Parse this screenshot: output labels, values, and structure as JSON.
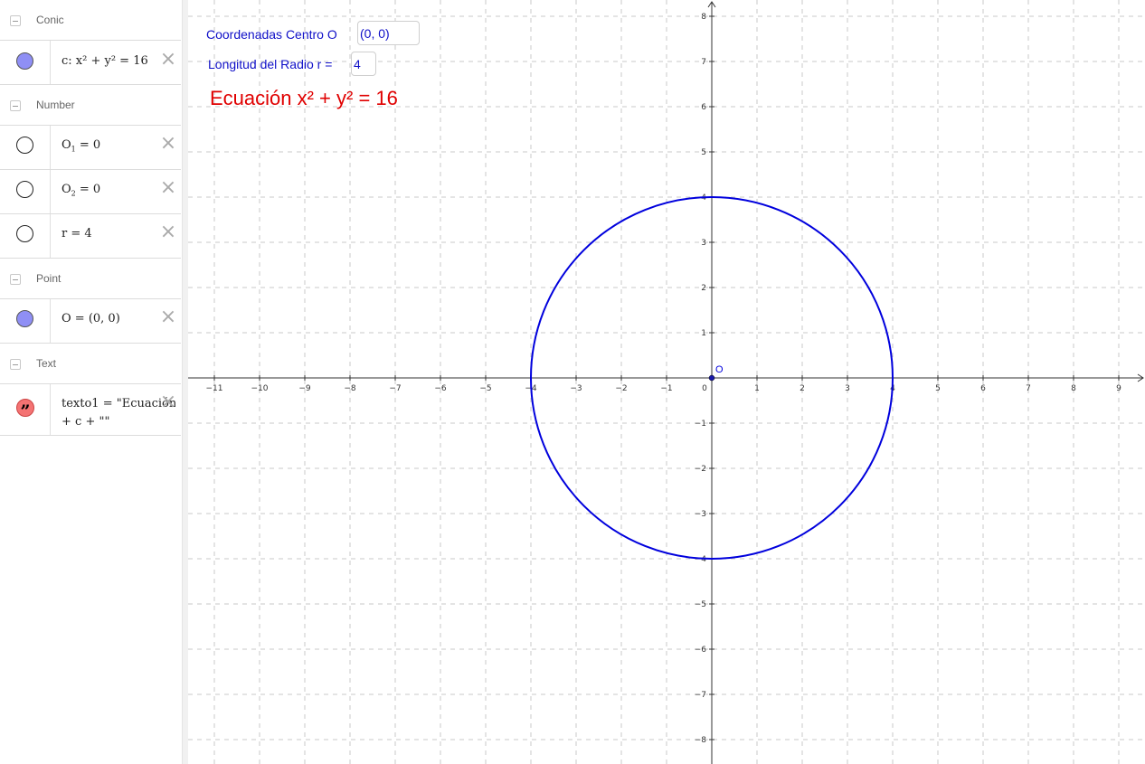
{
  "algebra": {
    "groups": [
      {
        "title": "Conic",
        "items": [
          {
            "expr": "c: x² + y² = 16",
            "icon": "filled-circle"
          }
        ]
      },
      {
        "title": "Number",
        "items": [
          {
            "expr_base": "O",
            "expr_sub": "1",
            "expr_rest": " = 0",
            "icon": "empty-circle"
          },
          {
            "expr_base": "O",
            "expr_sub": "2",
            "expr_rest": " = 0",
            "icon": "empty-circle"
          },
          {
            "expr": "r = 4",
            "icon": "empty-circle"
          }
        ]
      },
      {
        "title": "Point",
        "items": [
          {
            "expr": "O = (0, 0)",
            "icon": "filled-circle"
          }
        ]
      },
      {
        "title": "Text",
        "items": [
          {
            "expr_line1": "texto1 = \"Ecuación \"",
            "expr_line2": "+ c + \"\"",
            "icon": "quote-icon"
          }
        ]
      }
    ],
    "delete_glyph": "×"
  },
  "graphics": {
    "center_label": "Coordenadas Centro O",
    "center_value": "(0, 0)",
    "radius_label": "Longitud del Radio r =",
    "radius_value": "4",
    "equation": "Ecuación x² + y² = 16",
    "point_label": "O",
    "x_range": [
      -11,
      9
    ],
    "y_range": [
      -8,
      8
    ],
    "circle": {
      "center": [
        0,
        0
      ],
      "radius": 4
    },
    "point": [
      0,
      0
    ],
    "colors": {
      "circle": "#0000dd",
      "text_blue": "#1010c8",
      "equation": "#e00000",
      "grid": "#c8c8c8"
    }
  }
}
